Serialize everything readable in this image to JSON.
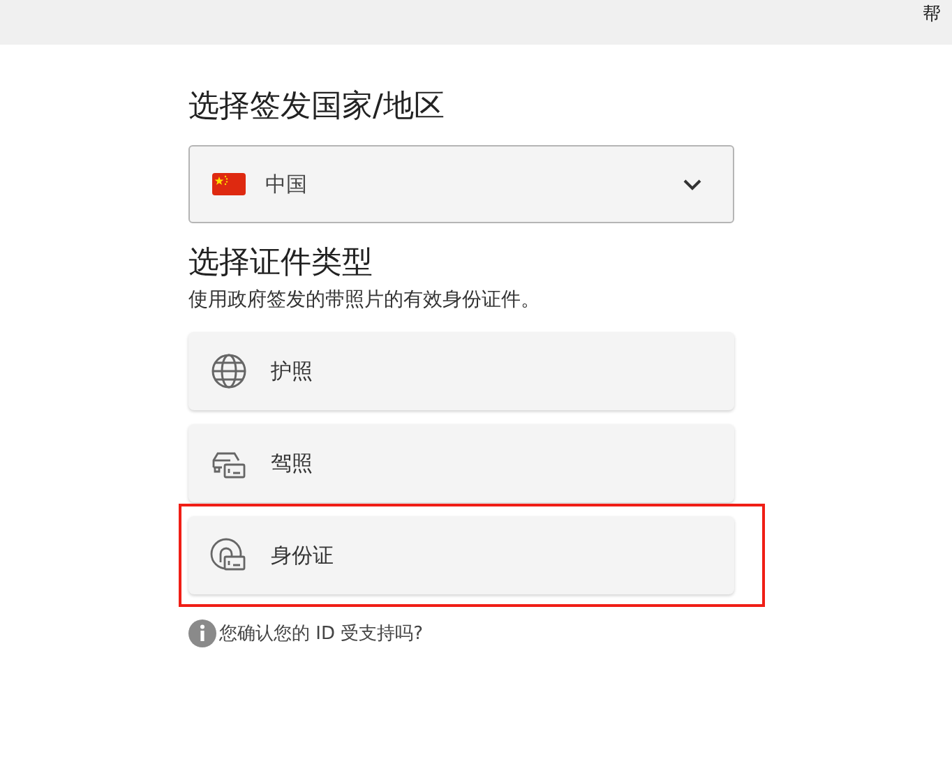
{
  "top_bar": {
    "help_link": "帮"
  },
  "country": {
    "heading": "选择签发国家/地区",
    "value": "中国"
  },
  "document_type": {
    "heading": "选择证件类型",
    "description": "使用政府签发的带照片的有效身份证件。",
    "options": [
      {
        "kind": "passport",
        "label": "护照",
        "highlighted": false
      },
      {
        "kind": "license",
        "label": "驾照",
        "highlighted": false
      },
      {
        "kind": "idcard",
        "label": "身份证",
        "highlighted": true
      }
    ]
  },
  "help_note": "您确认您的 ID 受支持吗?"
}
